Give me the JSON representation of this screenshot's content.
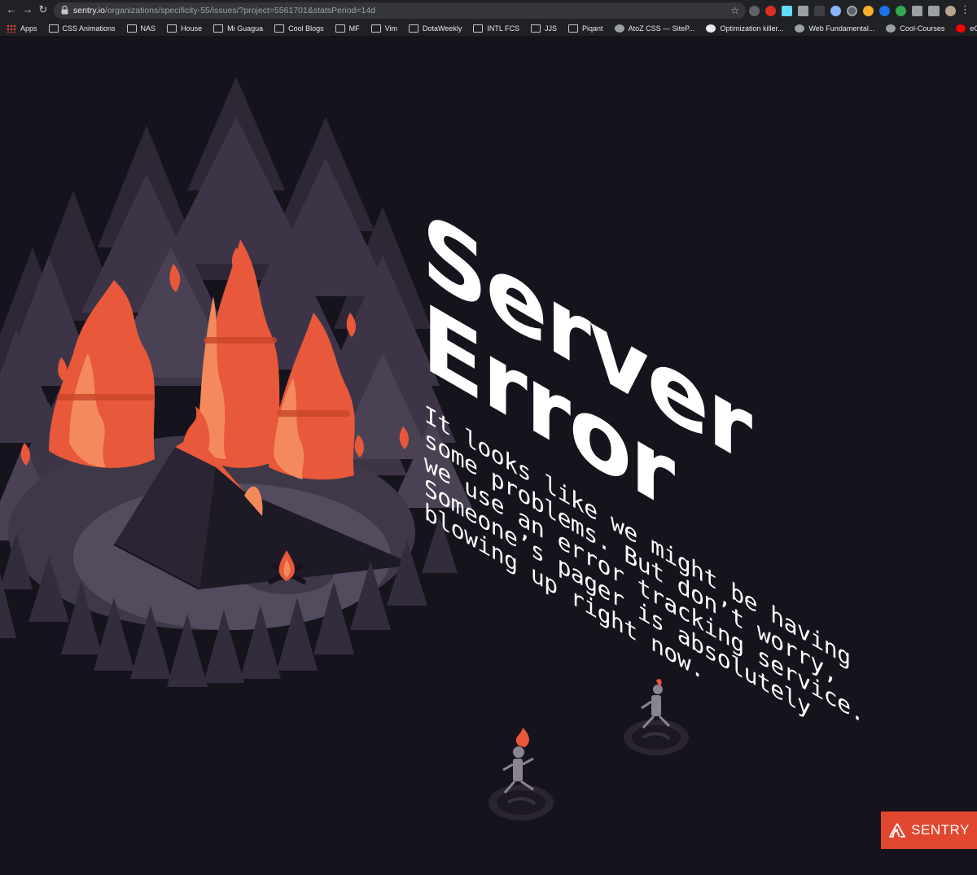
{
  "browser": {
    "url_host": "sentry.io",
    "url_path": "/organizations/specificity-55/issues/?project=5561701&statsPeriod=14d",
    "bookmarks": [
      {
        "label": "Apps",
        "icon": "apps-grid-icon"
      },
      {
        "label": "CSS Animations",
        "icon": "folder-icon"
      },
      {
        "label": "NAS",
        "icon": "folder-icon"
      },
      {
        "label": "House",
        "icon": "folder-icon"
      },
      {
        "label": "Mi Guagua",
        "icon": "folder-icon"
      },
      {
        "label": "Cool Blogs",
        "icon": "folder-icon"
      },
      {
        "label": "MF",
        "icon": "folder-icon"
      },
      {
        "label": "Vim",
        "icon": "folder-icon"
      },
      {
        "label": "DotaWeekly",
        "icon": "folder-icon"
      },
      {
        "label": "INTL FCS",
        "icon": "folder-icon"
      },
      {
        "label": "JJS",
        "icon": "folder-icon"
      },
      {
        "label": "Piqant",
        "icon": "folder-icon"
      },
      {
        "label": "AtoZ CSS — SiteP...",
        "icon": "site-icon"
      },
      {
        "label": "Optimization killer...",
        "icon": "github-icon"
      },
      {
        "label": "Web Fundamental...",
        "icon": "site-icon"
      },
      {
        "label": "Cool-Courses",
        "icon": "site-icon"
      },
      {
        "label": "eCommerce Busin...",
        "icon": "youtube-icon"
      }
    ]
  },
  "page": {
    "title_line1": "Server",
    "title_line2": "Error",
    "message_lines": [
      "It looks like we might be having",
      "some problems. But don’t worry,",
      "we use an error tracking service.",
      "Someone’s pager is absolutely",
      "blowing up right now."
    ],
    "brand": "SENTRY"
  },
  "colors": {
    "background": "#15131c",
    "tree_dark": "#3b3444",
    "tree_mid": "#4d4558",
    "flame": "#e8583a",
    "flame_light": "#f48a5c",
    "brand": "#e1472e"
  }
}
